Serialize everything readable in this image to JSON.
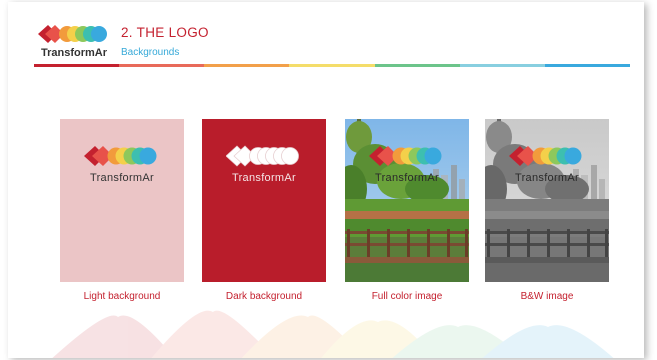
{
  "header": {
    "brand": "TransformAr",
    "section_title": "2. THE LOGO",
    "section_subtitle": "Backgrounds"
  },
  "cards": [
    {
      "label": "Light background",
      "logo_text": "TransformAr",
      "background": "light-pink"
    },
    {
      "label": "Dark background",
      "logo_text": "TransformAr",
      "background": "brand-red"
    },
    {
      "label": "Full color image",
      "logo_text": "TransformAr",
      "background": "photo-color"
    },
    {
      "label": "B&W image",
      "logo_text": "TransformAr",
      "background": "photo-bw"
    }
  ],
  "colors": {
    "brand_red": "#c4212f",
    "subtitle_blue": "#36a9d8",
    "light_pink": "#ebc5c6",
    "dark_red": "#b91d2b",
    "logo_palette": [
      "#c4212f",
      "#e8524a",
      "#f29b3c",
      "#f4d04a",
      "#8dc85c",
      "#3dbfb0",
      "#39a9de"
    ],
    "bar_palette": [
      "#c4212f",
      "#e86a5a",
      "#f2a04a",
      "#f4dd6a",
      "#6cc48a",
      "#88cfe0",
      "#39a9de"
    ]
  },
  "icons": [
    "transformar-logo-mark"
  ]
}
